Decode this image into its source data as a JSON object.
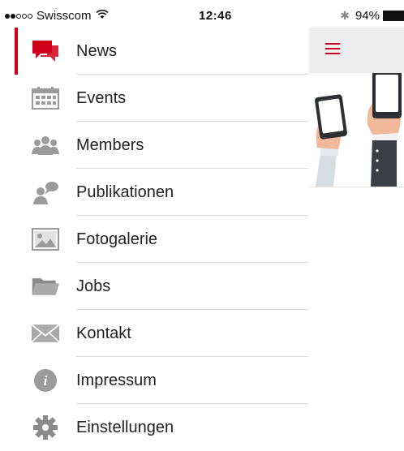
{
  "status_bar": {
    "carrier": "Swisscom",
    "time": "12:46",
    "battery": "94%",
    "signal_bars_filled": 2,
    "signal_bars_total": 5
  },
  "menu": {
    "items": [
      {
        "label": "News",
        "icon": "chat-bubbles-icon",
        "active": true
      },
      {
        "label": "Events",
        "icon": "calendar-icon",
        "active": false
      },
      {
        "label": "Members",
        "icon": "people-group-icon",
        "active": false
      },
      {
        "label": "Publikationen",
        "icon": "person-speech-icon",
        "active": false
      },
      {
        "label": "Fotogalerie",
        "icon": "photo-gallery-icon",
        "active": false
      },
      {
        "label": "Jobs",
        "icon": "folder-icon",
        "active": false
      },
      {
        "label": "Kontakt",
        "icon": "envelope-icon",
        "active": false
      },
      {
        "label": "Impressum",
        "icon": "info-icon",
        "active": false
      },
      {
        "label": "Einstellungen",
        "icon": "gear-icon",
        "active": false
      }
    ]
  },
  "colors": {
    "accent": "#d0021b",
    "icon_gray": "#9b9b9b",
    "header_bg": "#eeeeee"
  }
}
